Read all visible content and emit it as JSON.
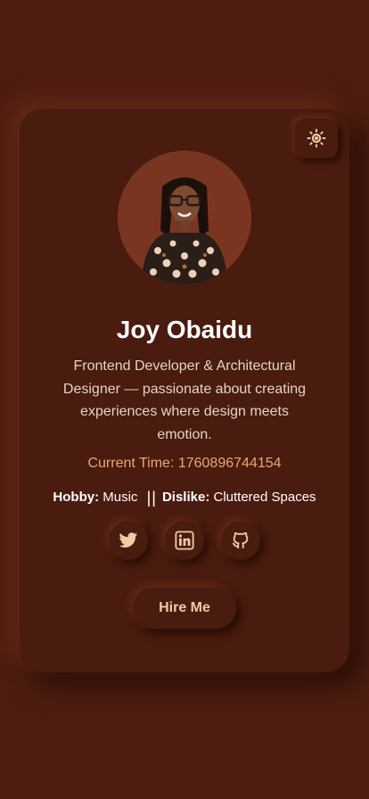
{
  "profile": {
    "name": "Joy Obaidu",
    "bio": "Frontend Developer & Architectural Designer — passionate about creating experiences where design meets emotion.",
    "time_label": "Current Time: ",
    "time_value": "1760896744154",
    "hobby_label": "Hobby:",
    "hobby_value": " Music ",
    "separator": "||",
    "dislike_label": "Dislike:",
    "dislike_value": " Cluttered Spaces",
    "hire_label": "Hire Me"
  },
  "icons": {
    "theme": "sun-icon",
    "social": [
      "twitter-icon",
      "linkedin-icon",
      "github-icon"
    ]
  },
  "colors": {
    "background": "#4e1d10",
    "card": "#4a1b0f",
    "accent": "#f3c9a4",
    "time": "#e7a872"
  }
}
